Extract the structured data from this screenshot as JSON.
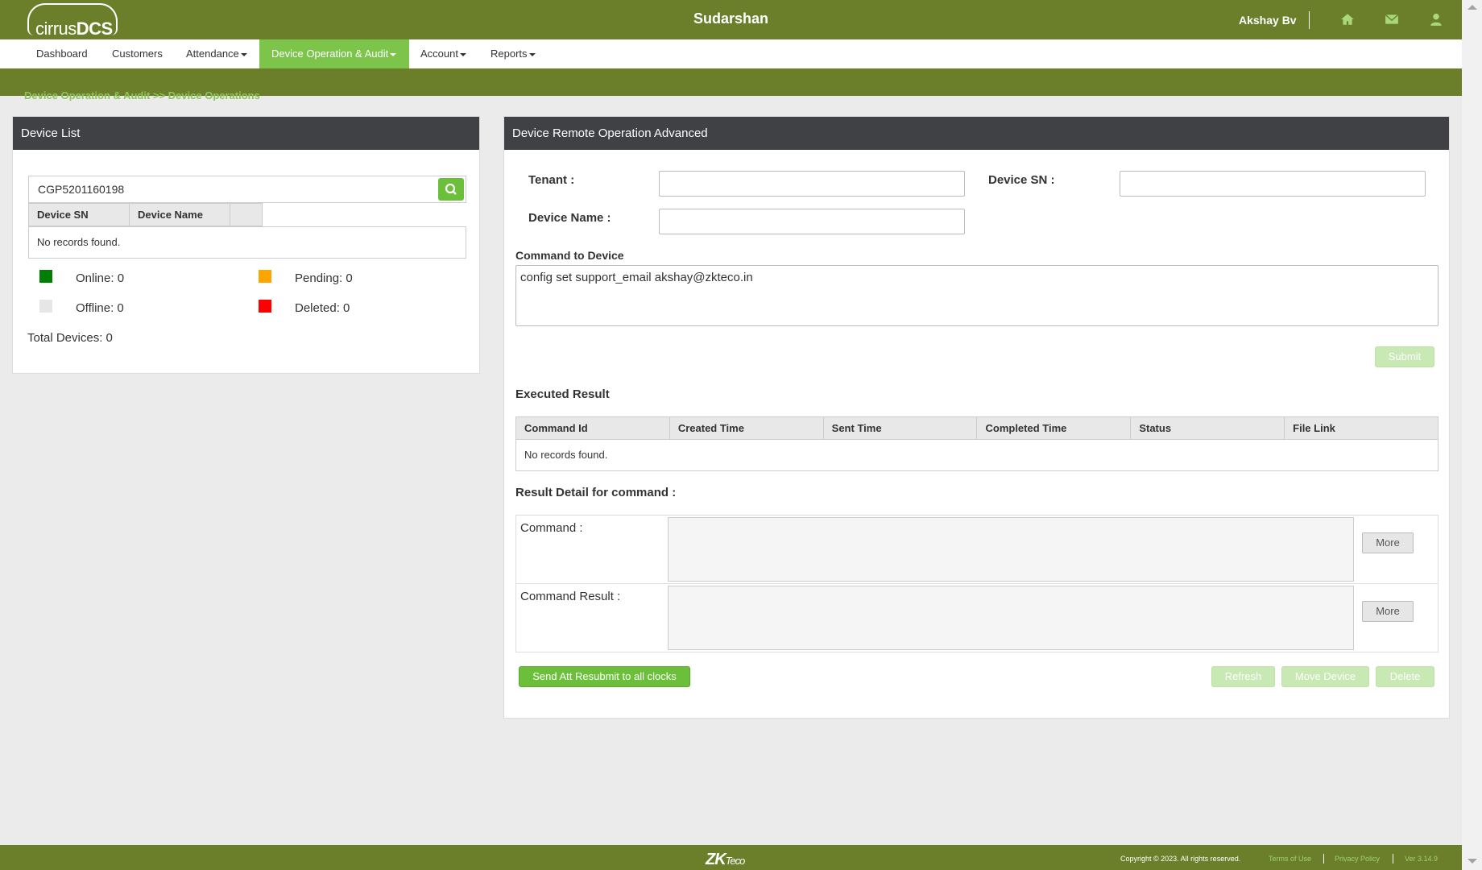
{
  "header": {
    "logo_text_light": "cirrus",
    "logo_text_bold": "DCS",
    "title": "Sudarshan",
    "user": "Akshay Bv"
  },
  "icons": {
    "home": "home-icon",
    "mail": "mail-icon",
    "user": "user-icon",
    "search": "search-icon"
  },
  "nav": {
    "items": [
      {
        "label": "Dashboard"
      },
      {
        "label": "Customers"
      },
      {
        "label": "Attendance"
      },
      {
        "label": "Device Operation & Audit"
      },
      {
        "label": "Account"
      },
      {
        "label": "Reports"
      }
    ]
  },
  "breadcrumb": "Device Operation & Audit >> Device Operations",
  "device_list": {
    "title": "Device List",
    "search_value": "CGP5201160198",
    "columns": [
      "Device SN",
      "Device Name",
      ""
    ],
    "empty": "No records found.",
    "legend": {
      "online": "Online: 0",
      "pending": "Pending: 0",
      "offline": "Offline: 0",
      "deleted": "Deleted: 0"
    },
    "total": "Total Devices: 0"
  },
  "remote": {
    "title": "Device Remote Operation Advanced",
    "tenant_label": "Tenant :",
    "sn_label": "Device SN :",
    "name_label": "Device Name :",
    "command_label": "Command to Device",
    "command_value": "config set support_email akshay@zkteco.in",
    "submit": "Submit",
    "executed_title": "Executed Result",
    "columns": [
      "Command Id",
      "Created Time",
      "Sent Time",
      "Completed Time",
      "Status",
      "File Link"
    ],
    "empty": "No records found.",
    "detail_title": "Result Detail for command :",
    "command_lbl": "Command :",
    "result_lbl": "Command Result :",
    "more": "More",
    "send_all": "Send Att Resubmit to all clocks",
    "refresh": "Refresh",
    "move": "Move Device",
    "delete": "Delete"
  },
  "footer": {
    "brand": "ZK",
    "brand_sub": "Teco",
    "copyright": "Copyright © 2023. All rights reserved.",
    "terms": "Terms of Use",
    "privacy": "Privacy Policy",
    "version": "Ver 3.14.9"
  },
  "colors": {
    "header_green": "#6b7f2a",
    "accent_green": "#7cc44a",
    "online": "#008000",
    "pending": "#ffa500",
    "offline": "#e6e6e6",
    "deleted": "#ff0000"
  }
}
